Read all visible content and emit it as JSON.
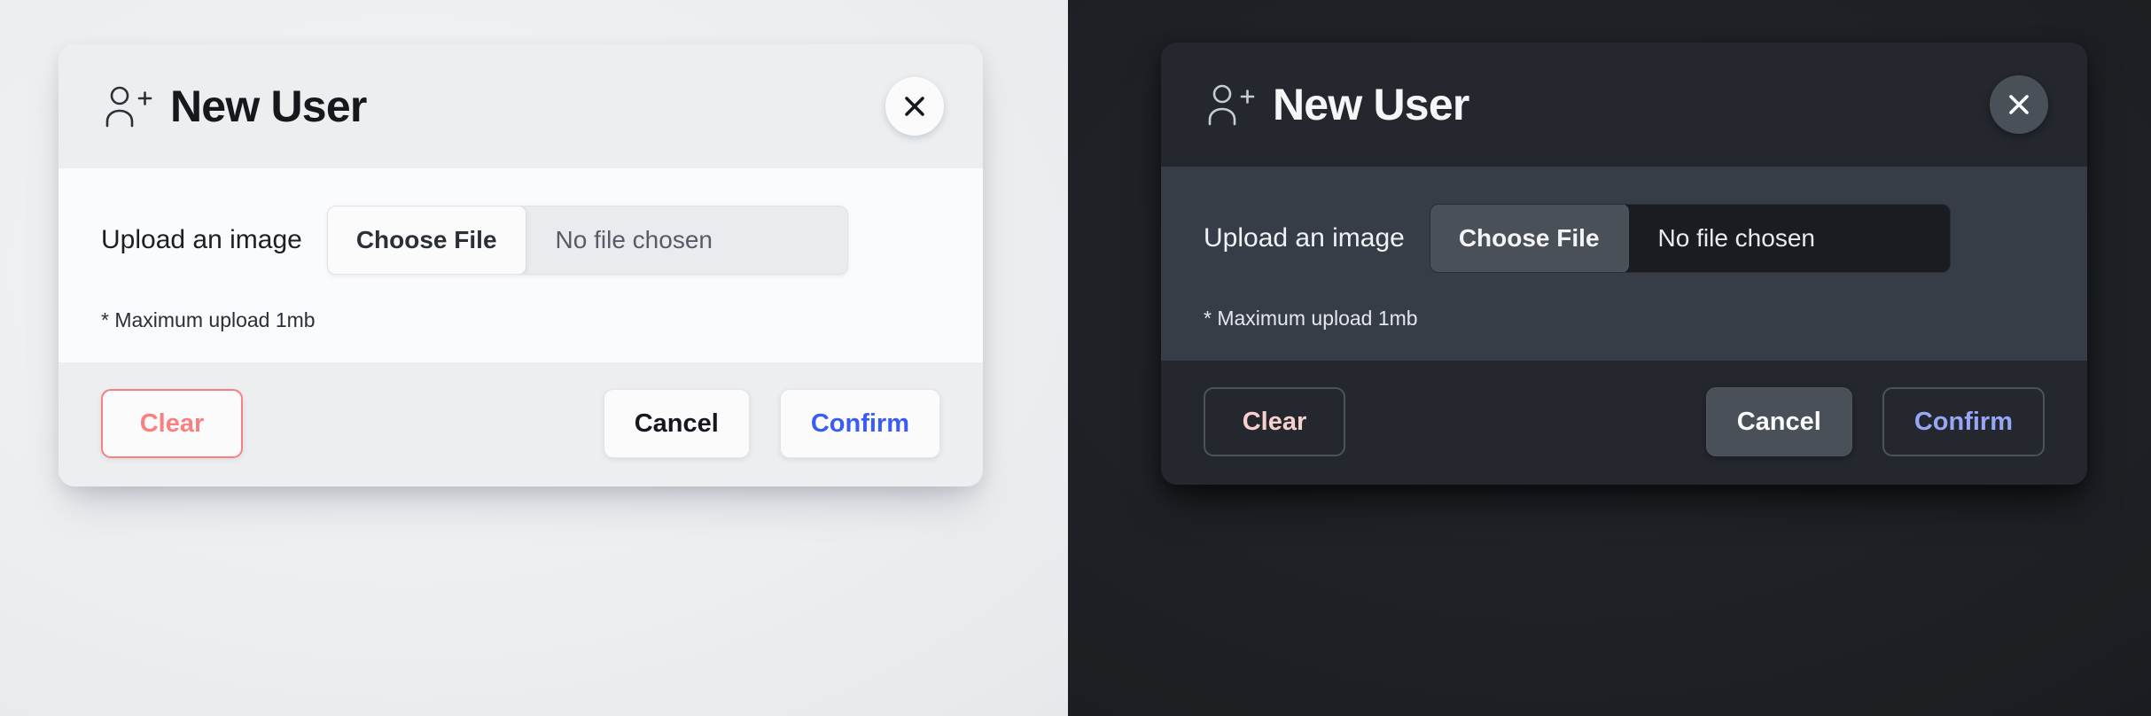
{
  "panes": [
    {
      "theme": "light",
      "dialog": {
        "icon": "user-plus-icon",
        "title": "New User",
        "close_icon": "close-icon",
        "upload_label": "Upload an image",
        "choose_file_label": "Choose File",
        "file_status": "No file chosen",
        "hint": "* Maximum upload 1mb",
        "clear_label": "Clear",
        "cancel_label": "Cancel",
        "confirm_label": "Confirm"
      },
      "colors": {
        "background": "#eceef0",
        "header": "#eceef0",
        "body": "#fafbfc",
        "footer": "#eceef0",
        "title": "#15181d",
        "clear": "#f98080",
        "cancel": "#14181e",
        "confirm": "#3b5bf5"
      }
    },
    {
      "theme": "dark",
      "dialog": {
        "icon": "user-plus-icon",
        "title": "New User",
        "close_icon": "close-icon",
        "upload_label": "Upload an image",
        "choose_file_label": "Choose File",
        "file_status": "No file chosen",
        "hint": "* Maximum upload 1mb",
        "clear_label": "Clear",
        "cancel_label": "Cancel",
        "confirm_label": "Confirm"
      },
      "colors": {
        "background": "#1d2024",
        "header": "#24272d",
        "body": "#373d47",
        "footer": "#24272d",
        "title": "#f5f6f8",
        "clear": "#f8cfcf",
        "cancel": "#fafbfc",
        "confirm": "#97a6f5"
      }
    }
  ]
}
